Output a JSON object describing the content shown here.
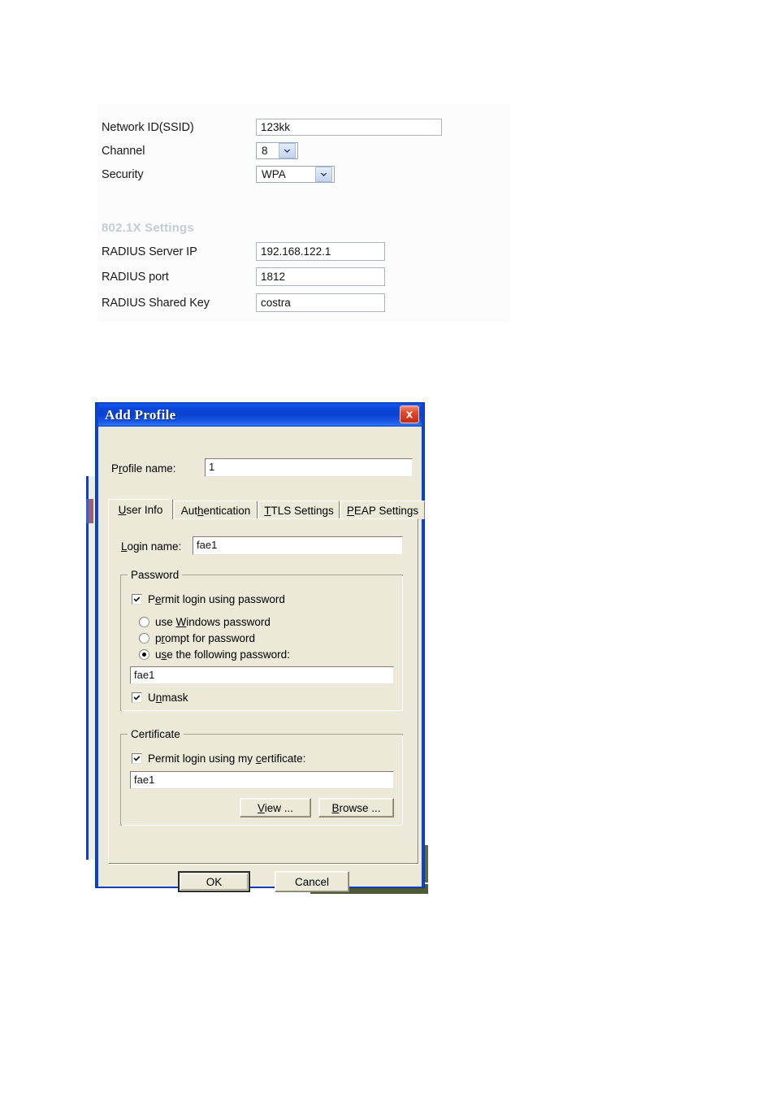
{
  "webform": {
    "fields": [
      {
        "label": "Network ID(SSID)",
        "value": "123kk",
        "kind": "text"
      },
      {
        "label": "Channel",
        "value": "8",
        "kind": "select"
      },
      {
        "label": "Security",
        "value": "WPA",
        "kind": "select"
      }
    ],
    "section_title": "802.1X Settings",
    "radius_fields": [
      {
        "label": "RADIUS Server IP",
        "value": "192.168.122.1"
      },
      {
        "label": "RADIUS port",
        "value": "1812"
      },
      {
        "label": "RADIUS Shared Key",
        "value": "costra"
      }
    ]
  },
  "dialog": {
    "title": "Add Profile",
    "close_label": "x",
    "profile_name_label": "Profile name:",
    "profile_name_value": "1",
    "tabs": [
      {
        "label": "User Info",
        "active": true
      },
      {
        "label": "Authentication",
        "active": false
      },
      {
        "label": "TTLS Settings",
        "active": false
      },
      {
        "label": "PEAP Settings",
        "active": false
      }
    ],
    "login_name_label": "Login name:",
    "login_name_value": "fae1",
    "password_group": {
      "title": "Password",
      "permit_label": "Permit login using password",
      "permit_checked": true,
      "options": [
        {
          "label": "use Windows password",
          "selected": false
        },
        {
          "label": "prompt for password",
          "selected": false
        },
        {
          "label": "use the following password:",
          "selected": true
        }
      ],
      "password_value": "fae1",
      "unmask_label": "Unmask",
      "unmask_checked": true
    },
    "certificate_group": {
      "title": "Certificate",
      "permit_label": "Permit login using my certificate:",
      "permit_checked": true,
      "certificate_value": "fae1",
      "view_label": "View ...",
      "browse_label": "Browse ..."
    },
    "ok_label": "OK",
    "cancel_label": "Cancel"
  },
  "colors": {
    "titlebar_blue": "#0a43d6",
    "dialog_face": "#ece9d8",
    "close_red": "#c42b12",
    "section_title_gray": "#c3cbd4",
    "field_border": "#a8b4c4"
  }
}
